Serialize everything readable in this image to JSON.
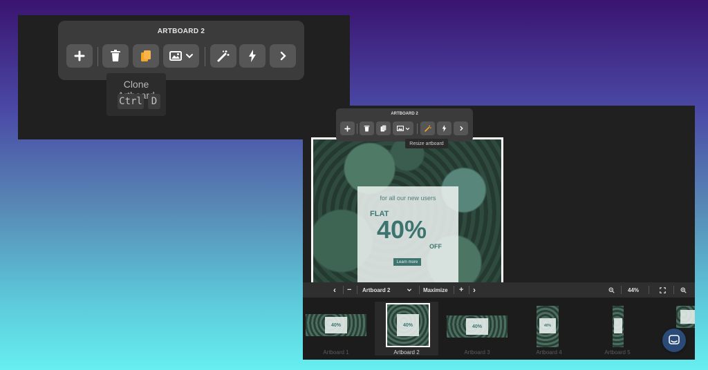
{
  "panel_large": {
    "toolbar_title": "ARTBOARD 2",
    "tooltip": {
      "label": "Clone Artboard",
      "keys": [
        "Ctrl",
        "D"
      ]
    },
    "buttons": [
      {
        "icon": "plus-icon"
      },
      {
        "icon": "trash-icon"
      },
      {
        "icon": "copy-icon",
        "active_color": "#f5a623"
      },
      {
        "icon": "image-icon",
        "dropdown": true
      },
      {
        "icon": "magic-wand-icon"
      },
      {
        "icon": "lightning-icon"
      },
      {
        "icon": "chevron-right-icon"
      }
    ]
  },
  "panel_editor": {
    "toolbar_title": "ARTBOARD 2",
    "tooltip": "Resize artboard",
    "artboard": {
      "subtitle": "for all our new users",
      "flat": "FLAT",
      "percent": "40%",
      "off": "OFF",
      "cta": "Learn more"
    },
    "nav": {
      "prev": "‹",
      "minus": "−",
      "current": "Artboard 2",
      "maximize": "Maximize",
      "plus": "+",
      "next": "›",
      "zoom": "44%"
    },
    "thumbnails": [
      {
        "label": "Artboard 1",
        "mini_text": "40%"
      },
      {
        "label": "Artboard 2",
        "mini_text": "40%"
      },
      {
        "label": "Artboard 3",
        "mini_text": "40%"
      },
      {
        "label": "Artboard 4",
        "mini_text": "40%"
      },
      {
        "label": "Artboard 5",
        "mini_text": ""
      },
      {
        "label": "",
        "mini_text": ""
      }
    ]
  },
  "colors": {
    "accent": "#f5a623",
    "promo_text": "#3d7470"
  }
}
